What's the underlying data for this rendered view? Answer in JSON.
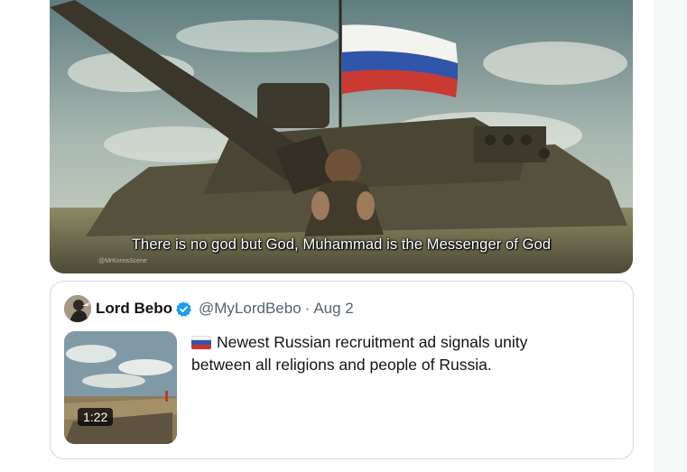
{
  "video": {
    "subtitle": "There is no god but God, Muhammad is the Messenger of God",
    "watermark": "@MrKoreaScene"
  },
  "quoted_post": {
    "author_name": "Lord Bebo",
    "handle": "@MyLordBebo",
    "separator": "·",
    "date": "Aug 2",
    "text": "Newest Russian recruitment ad signals unity between all religions and people of Russia.",
    "flag_icon": "russia-flag-icon",
    "verified_icon": "verified-badge-icon",
    "thumbnail_duration": "1:22"
  },
  "colors": {
    "verified_blue": "#1d9bf0",
    "secondary_text": "#536471",
    "border": "#cfd9de"
  }
}
